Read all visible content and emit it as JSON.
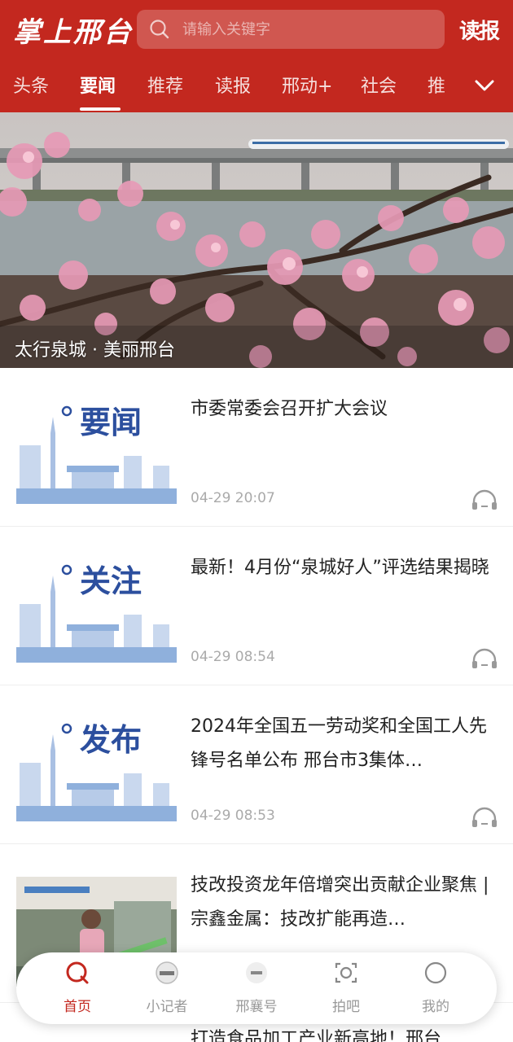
{
  "header": {
    "logo_text": "掌上邢台",
    "search_placeholder": "请输入关键字",
    "read_paper_label": "读报",
    "accent_color": "#c3281f"
  },
  "tabs": [
    {
      "label": "头条"
    },
    {
      "label": "要闻"
    },
    {
      "label": "推荐"
    },
    {
      "label": "读报"
    },
    {
      "label": "邢动+"
    },
    {
      "label": "社会"
    },
    {
      "label": "推"
    }
  ],
  "active_tab": "要闻",
  "banner": {
    "caption": "太行泉城 · 美丽邢台"
  },
  "news": [
    {
      "thumb_label": "要闻",
      "title": "市委常委会召开扩大会议",
      "time": "04-29 20:07"
    },
    {
      "thumb_label": "关注",
      "title": "最新！4月份“泉城好人”评选结果揭晓",
      "time": "04-29 08:54"
    },
    {
      "thumb_label": "发布",
      "title": "2024年全国五一劳动奖和全国工人先锋号名单公布 邢台市3集体…",
      "time": "04-29 08:53"
    },
    {
      "thumb_label": "",
      "title": "技改投资龙年倍增突出贡献企业聚焦 | 宗鑫金属：技改扩能再造…",
      "time": ""
    }
  ],
  "peek_title": "打造食品加工产业新高地！邢台",
  "bottom_nav": [
    {
      "label": "首页",
      "icon": "home-icon"
    },
    {
      "label": "小记者",
      "icon": "reporter-badge-icon"
    },
    {
      "label": "邢襄号",
      "icon": "xingxiang-badge-icon"
    },
    {
      "label": "拍吧",
      "icon": "camera-icon"
    },
    {
      "label": "我的",
      "icon": "profile-icon"
    }
  ]
}
